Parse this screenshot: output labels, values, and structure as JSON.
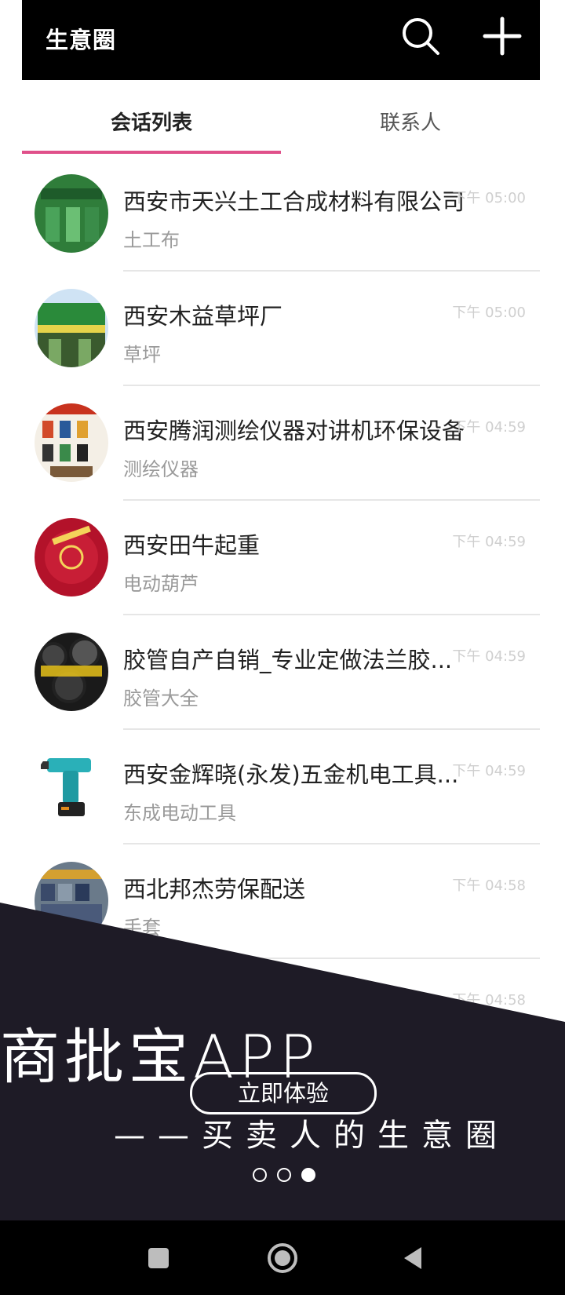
{
  "header": {
    "title": "生意圈",
    "search_icon": "search-icon",
    "add_icon": "plus-icon"
  },
  "tabs": [
    {
      "label": "会话列表",
      "active": true
    },
    {
      "label": "联系人",
      "active": false
    }
  ],
  "accent_color": "#e0508a",
  "conversations": [
    {
      "name": "西安市天兴土工合成材料有限公司",
      "subtitle": "土工布",
      "time": "下午 05:00"
    },
    {
      "name": "西安木益草坪厂",
      "subtitle": "草坪",
      "time": "下午 05:00"
    },
    {
      "name": "西安腾润测绘仪器对讲机环保设备",
      "subtitle": "测绘仪器",
      "time": "下午 04:59"
    },
    {
      "name": "西安田牛起重",
      "subtitle": "电动葫芦",
      "time": "下午 04:59"
    },
    {
      "name": "胶管自产自销_专业定做法兰胶...",
      "subtitle": "胶管大全",
      "time": "下午 04:59"
    },
    {
      "name": "西安金辉晓(永发)五金机电工具...",
      "subtitle": "东成电动工具",
      "time": "下午 04:59"
    },
    {
      "name": "西北邦杰劳保配送",
      "subtitle": "手套",
      "time": "下午 04:58"
    },
    {
      "name": "",
      "subtitle": "",
      "time": "下午 04:58"
    }
  ],
  "promo": {
    "title": "商批宝APP",
    "cta": "立即体验",
    "slogan": "——买卖人的生意圈",
    "dots_total": 3,
    "dots_active_index": 2
  },
  "navigation": {
    "recent_icon": "square-icon",
    "home_icon": "circle-home-icon",
    "back_icon": "triangle-back-icon"
  }
}
